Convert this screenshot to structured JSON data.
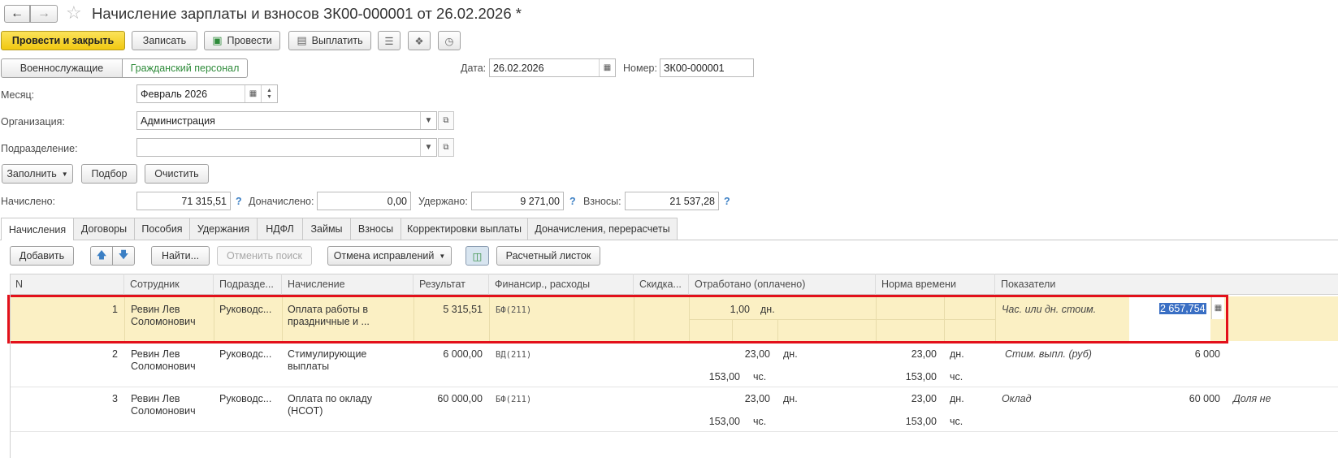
{
  "window": {
    "title": "Начисление зарплаты и взносов ЗК00-000001 от 26.02.2026 *"
  },
  "toolbar": {
    "post_close": "Провести и закрыть",
    "save": "Записать",
    "post": "Провести",
    "pay": "Выплатить"
  },
  "mode_tabs": [
    "Военнослужащие",
    "Гражданский персонал"
  ],
  "header": {
    "date_label": "Дата:",
    "date": "26.02.2026",
    "number_label": "Номер:",
    "number": "ЗК00-000001",
    "month_label": "Месяц:",
    "month": "Февраль 2026",
    "org_label": "Организация:",
    "org": "Администрация",
    "dept_label": "Подразделение:",
    "dept": ""
  },
  "actions": {
    "fill": "Заполнить",
    "pick": "Подбор",
    "clear": "Очистить"
  },
  "totals": {
    "accrued_label": "Начислено:",
    "accrued": "71 315,51",
    "additional_label": "Доначислено:",
    "additional": "0,00",
    "withheld_label": "Удержано:",
    "withheld": "9 271,00",
    "contrib_label": "Взносы:",
    "contrib": "21 537,28",
    "help": "?"
  },
  "tabs": [
    "Начисления",
    "Договоры",
    "Пособия",
    "Удержания",
    "НДФЛ",
    "Займы",
    "Взносы",
    "Корректировки выплаты",
    "Доначисления, перерасчеты"
  ],
  "table_toolbar": {
    "add": "Добавить",
    "find": "Найти...",
    "cancel_search": "Отменить поиск",
    "cancel_corrections": "Отмена исправлений",
    "payslip": "Расчетный листок"
  },
  "columns": [
    "N",
    "Сотрудник",
    "Подразде...",
    "Начисление",
    "Результат",
    "Финансир., расходы",
    "Скидка...",
    "Отработано (оплачено)",
    "Норма времени",
    "Показатели"
  ],
  "rows": [
    {
      "n": "1",
      "employee_1": "Ревин Лев",
      "employee_2": "Соломонович",
      "dept": "Руководс...",
      "accrual_1": "Оплата работы в",
      "accrual_2": "праздничные и ...",
      "result": "5 315,51",
      "fin": "БФ(211)",
      "worked_days": "1,00",
      "days_unit": "дн.",
      "indicator": "Час. или дн. стоим.",
      "indicator_value": "2 657,754"
    },
    {
      "n": "2",
      "employee_1": "Ревин Лев",
      "employee_2": "Соломонович",
      "dept": "Руководс...",
      "accrual_1": "Стимулирующие",
      "accrual_2": "выплаты",
      "result": "6 000,00",
      "fin": "ВД(211)",
      "worked_days": "23,00",
      "days_unit": "дн.",
      "worked_hours": "153,00",
      "hours_unit": "чс.",
      "norm_days": "23,00",
      "norm_days_unit": "дн.",
      "norm_hours": "153,00",
      "norm_hours_unit": "чс.",
      "indicator": "Стим. выпл. (руб)",
      "indicator_value": "6 000"
    },
    {
      "n": "3",
      "employee_1": "Ревин Лев",
      "employee_2": "Соломонович",
      "dept": "Руководс...",
      "accrual_1": "Оплата по окладу",
      "accrual_2": "(НСОТ)",
      "result": "60 000,00",
      "fin": "БФ(211)",
      "worked_days": "23,00",
      "days_unit": "дн.",
      "worked_hours": "153,00",
      "hours_unit": "чс.",
      "norm_days": "23,00",
      "norm_days_unit": "дн.",
      "norm_hours": "153,00",
      "norm_hours_unit": "чс.",
      "indicator": "Оклад",
      "indicator_value": "60 000",
      "indicator_extra": "Доля не"
    }
  ]
}
